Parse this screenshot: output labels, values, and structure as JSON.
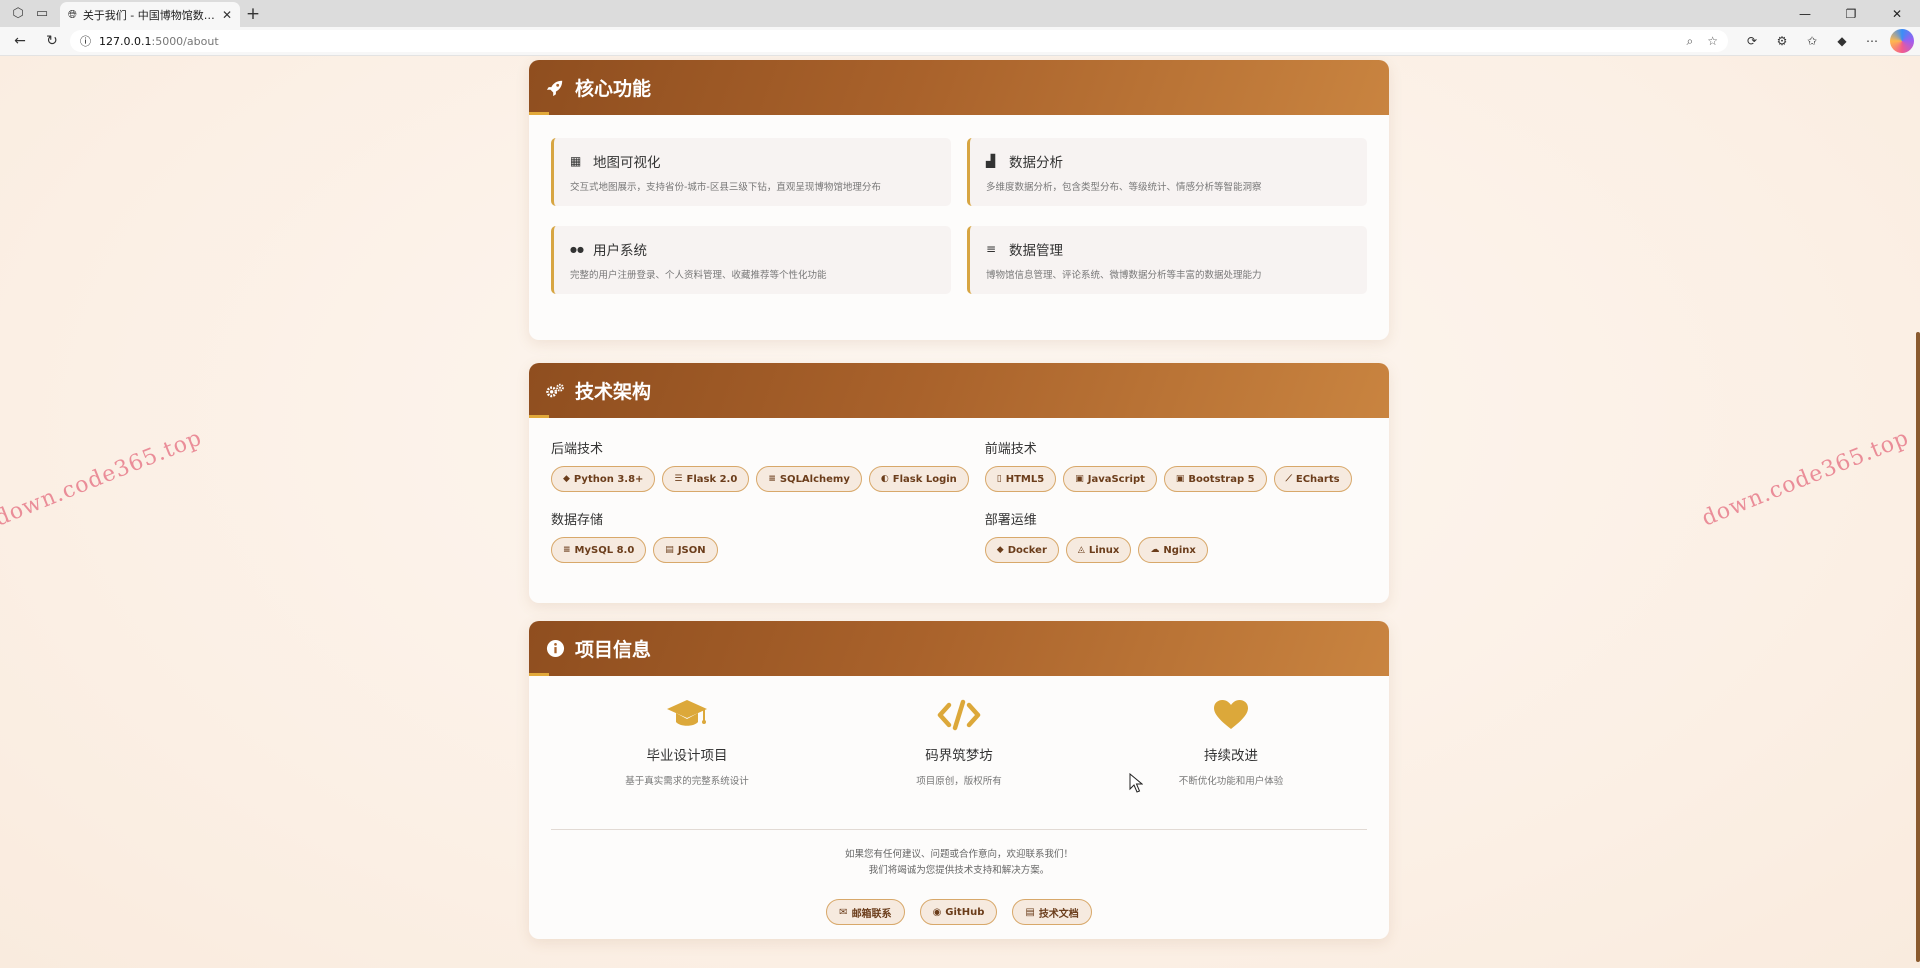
{
  "browser": {
    "tab_title": "关于我们 - 中国博物馆数据可视化",
    "url_host": "127.0.0.1",
    "url_path": ":5000/about"
  },
  "watermark": "down.code365.top",
  "features": {
    "title": "核心功能",
    "items": [
      {
        "icon": "map-icon",
        "glyph": "▦",
        "title": "地图可视化",
        "desc": "交互式地图展示，支持省份-城市-区县三级下钻，直观呈现博物馆地理分布"
      },
      {
        "icon": "chart-icon",
        "glyph": "▟",
        "title": "数据分析",
        "desc": "多维度数据分析，包含类型分布、等级统计、情感分析等智能洞察"
      },
      {
        "icon": "users-icon",
        "glyph": "●●",
        "title": "用户系统",
        "desc": "完整的用户注册登录、个人资料管理、收藏推荐等个性化功能"
      },
      {
        "icon": "database-icon",
        "glyph": "≡",
        "title": "数据管理",
        "desc": "博物馆信息管理、评论系统、微博数据分析等丰富的数据处理能力"
      }
    ]
  },
  "tech": {
    "title": "技术架构",
    "groups": [
      {
        "label": "后端技术",
        "chips": [
          {
            "icon": "python-icon",
            "glyph": "◆",
            "label": "Python 3.8+"
          },
          {
            "icon": "server-icon",
            "glyph": "☰",
            "label": "Flask 2.0"
          },
          {
            "icon": "database-icon",
            "glyph": "≡",
            "label": "SQLAlchemy"
          },
          {
            "icon": "shield-icon",
            "glyph": "◐",
            "label": "Flask Login"
          }
        ]
      },
      {
        "label": "前端技术",
        "chips": [
          {
            "icon": "html5-icon",
            "glyph": "▯",
            "label": "HTML5"
          },
          {
            "icon": "js-icon",
            "glyph": "▣",
            "label": "JavaScript"
          },
          {
            "icon": "bootstrap-icon",
            "glyph": "▣",
            "label": "Bootstrap 5"
          },
          {
            "icon": "line-chart-icon",
            "glyph": "⟋",
            "label": "ECharts"
          }
        ]
      },
      {
        "label": "数据存储",
        "chips": [
          {
            "icon": "database-icon",
            "glyph": "≡",
            "label": "MySQL 8.0"
          },
          {
            "icon": "file-icon",
            "glyph": "▤",
            "label": "JSON"
          }
        ]
      },
      {
        "label": "部署运维",
        "chips": [
          {
            "icon": "docker-icon",
            "glyph": "◆",
            "label": "Docker"
          },
          {
            "icon": "linux-icon",
            "glyph": "◬",
            "label": "Linux"
          },
          {
            "icon": "cloud-icon",
            "glyph": "☁",
            "label": "Nginx"
          }
        ]
      }
    ]
  },
  "project": {
    "title": "项目信息",
    "cols": [
      {
        "icon": "graduation-cap-icon",
        "title": "毕业设计项目",
        "sub": "基于真实需求的完整系统设计"
      },
      {
        "icon": "code-icon",
        "title": "码界筑梦坊",
        "sub": "项目原创，版权所有"
      },
      {
        "icon": "heart-icon",
        "title": "持续改进",
        "sub": "不断优化功能和用户体验"
      }
    ],
    "contact_line1": "如果您有任何建议、问题或合作意向，欢迎联系我们！",
    "contact_line2": "我们将竭诚为您提供技术支持和解决方案。",
    "buttons": [
      {
        "icon": "envelope-icon",
        "glyph": "✉",
        "label": "邮箱联系"
      },
      {
        "icon": "github-icon",
        "glyph": "◉",
        "label": "GitHub"
      },
      {
        "icon": "file-icon",
        "glyph": "▤",
        "label": "技术文档"
      }
    ]
  },
  "colors": {
    "header_start": "#8f4e1f",
    "header_end": "#c98440",
    "accent_gold": "#d7a542",
    "chip_border": "#d8a86a"
  }
}
